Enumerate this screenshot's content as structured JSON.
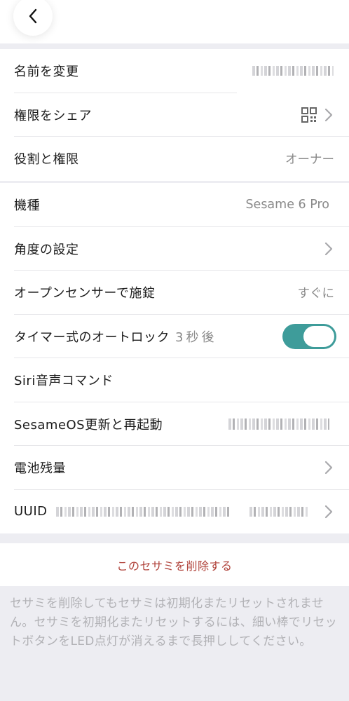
{
  "header": {
    "back_icon": "chevron-left-icon"
  },
  "section1": {
    "rows": [
      {
        "label": "名前を変更"
      },
      {
        "label": "権限をシェア",
        "icon": "qr-code-icon"
      },
      {
        "label": "役割と権限",
        "value": "オーナー"
      }
    ]
  },
  "section2": {
    "rows": [
      {
        "label": "機種",
        "value": "Sesame 6 Pro"
      },
      {
        "label": "角度の設定"
      },
      {
        "label": "オープンセンサーで施錠",
        "value": "すぐに"
      },
      {
        "label": "タイマー式のオートロック",
        "suffix": "3秒後",
        "toggle_on": true
      },
      {
        "label": "Siri音声コマンド"
      },
      {
        "label": "SesameOS更新と再起動"
      },
      {
        "label": "電池残量"
      },
      {
        "label": "UUID"
      }
    ]
  },
  "delete_label": "このセサミを削除する",
  "note": "セサミを削除してもセサミは初期化またリセットされません。セサミを初期化またリセットするには、細い棒でリセットボタンをLED点灯が消えるまで長押ししてください。",
  "colors": {
    "accent": "#3e9c9a",
    "danger": "#b0423a",
    "background": "#ededf2"
  }
}
